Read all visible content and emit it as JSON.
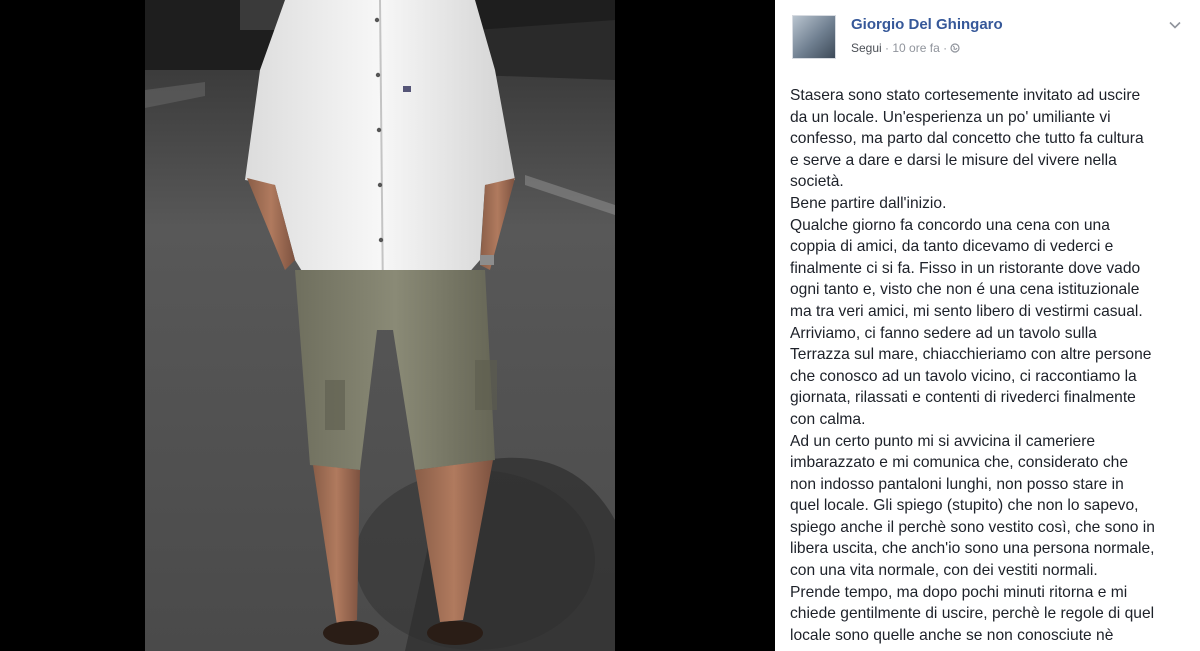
{
  "post": {
    "author": "Giorgio Del Ghingaro",
    "follow_label": "Segui",
    "separator": " · ",
    "time": "10 ore fa",
    "separator2": " · ",
    "privacy_icon": "globe-icon",
    "options_icon": "chevron-down-icon",
    "lines": [
      "Stasera sono stato cortesemente invitato ad uscire",
      "da un locale. Un'esperienza un po' umiliante vi",
      "confesso, ma parto dal concetto che tutto fa cultura",
      "e serve a dare e darsi le misure del vivere nella",
      "società.",
      "Bene partire dall'inizio.",
      "Qualche giorno fa concordo una cena con una",
      "coppia di amici, da tanto dicevamo di vederci e",
      "finalmente ci si fa. Fisso in un ristorante dove vado",
      "ogni tanto e, visto che non é una cena istituzionale",
      "ma tra veri amici, mi sento libero di vestirmi casual.",
      "Arriviamo, ci fanno sedere ad un tavolo sulla",
      "Terrazza sul mare, chiacchieriamo con altre persone",
      "che conosco ad un tavolo vicino, ci raccontiamo la",
      "giornata, rilassati e contenti di rivederci finalmente",
      "con calma.",
      "Ad un certo punto mi si avvicina il cameriere",
      "imbarazzato e mi comunica che, considerato che",
      "non indosso pantaloni lunghi, non posso stare in",
      "quel locale. Gli spiego (stupito) che non lo sapevo,",
      "spiego anche il perchè sono vestito così, che sono in",
      "libera uscita, che anch'io sono una persona normale,",
      "con una vita normale, con dei vestiti normali.",
      "Prende tempo, ma dopo pochi minuti ritorna e mi",
      "chiede gentilmente di uscire, perchè le regole di quel",
      "locale sono quelle anche se non conosciute nè"
    ]
  },
  "colors": {
    "author": "#365899",
    "meta": "#90949c",
    "text": "#1d2129",
    "photo_bg": "#000000"
  }
}
